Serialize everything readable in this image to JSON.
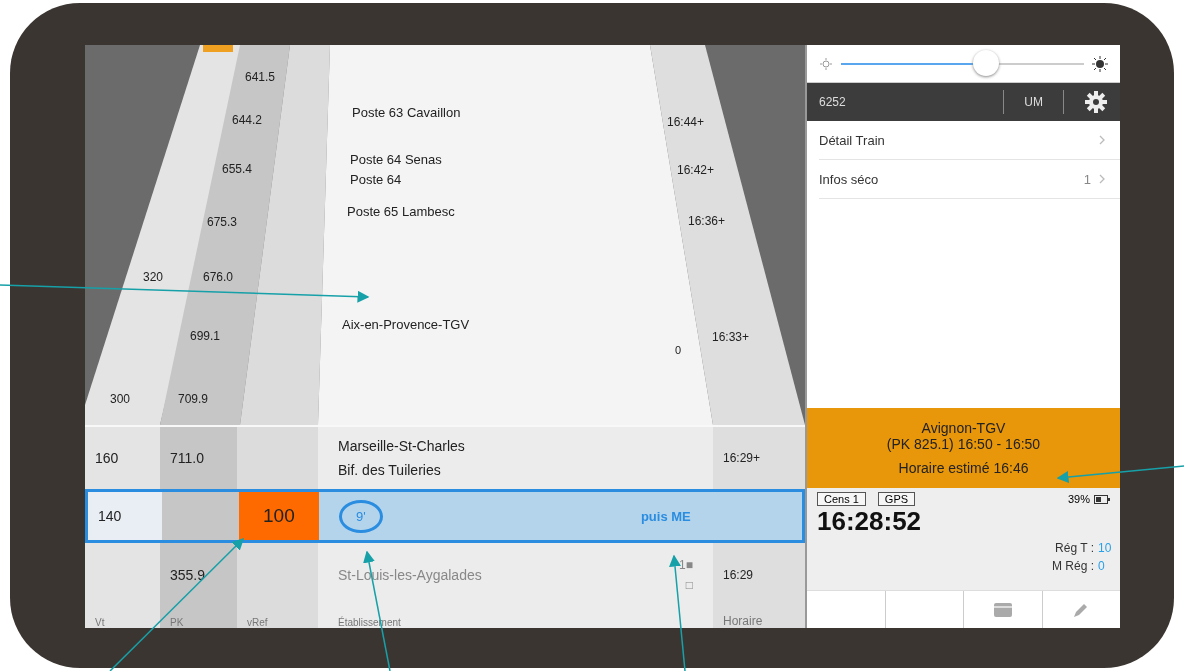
{
  "track": {
    "km": [
      "641.5",
      "644.2",
      "655.4",
      "675.3",
      "676.0",
      "699.1",
      "709.9"
    ],
    "speeds": [
      "320",
      "300"
    ],
    "places": [
      "Poste 63 Cavaillon",
      "Poste 64 Senas",
      "Poste 64",
      "Poste 65 Lambesc",
      "Aix-en-Provence-TGV"
    ],
    "marker": "0",
    "times": [
      "16:44+",
      "16:42+",
      "16:36+",
      "16:33+"
    ]
  },
  "rows": [
    {
      "kind": "station",
      "selected": false,
      "speed": "160",
      "km": "711.0",
      "places": [
        "Marseille-St-Charles",
        "Bif. des Tuileries"
      ],
      "time": "16:29+"
    },
    {
      "kind": "current",
      "selected": true,
      "speed": "140",
      "limit": "100",
      "delay": "9'",
      "note": "puis ME"
    },
    {
      "kind": "station",
      "selected": false,
      "km": "355.9",
      "places": [
        "St-Louis-les-Aygalades"
      ],
      "marks": [
        "1■",
        "□"
      ],
      "time": "16:29"
    }
  ],
  "columns": [
    "Vt",
    "PK",
    "vRef",
    "Établissement",
    "Horaire"
  ],
  "brightness": {
    "level": 0.6
  },
  "header": {
    "code": "6252",
    "mode": "UM"
  },
  "menu": [
    {
      "label": "Détail Train"
    },
    {
      "label": "Infos séco",
      "badge": "1"
    }
  ],
  "next_stop": {
    "name": "Avignon-TGV",
    "detail": "(PK 825.1) 16:50 - 16:50",
    "estimate": "Horaire estimé 16:46"
  },
  "status": {
    "tags": [
      "Cens 1",
      "GPS"
    ],
    "battery": "39%",
    "clock": "16:28:52",
    "readings": [
      {
        "label": "Rég T :",
        "value": "10"
      },
      {
        "label": "M Rég :",
        "value": "0"
      }
    ]
  }
}
